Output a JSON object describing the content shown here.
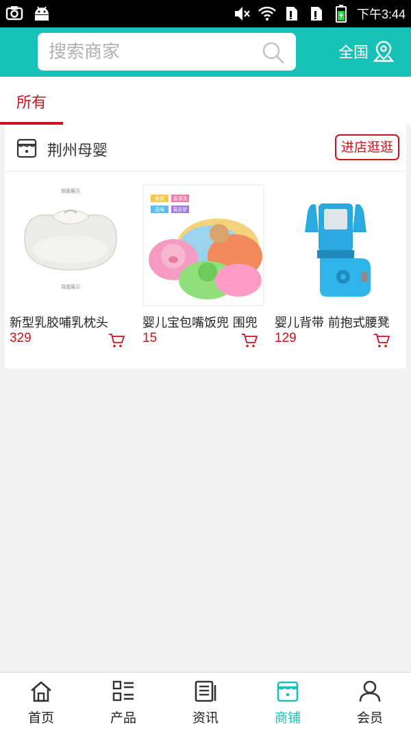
{
  "status_bar": {
    "time": "下午3:44",
    "icons": [
      "camera-icon",
      "android-icon",
      "mute-icon",
      "wifi-icon",
      "sim-icon",
      "sim-icon",
      "battery-icon"
    ]
  },
  "header": {
    "search_placeholder": "搜索商家",
    "region_label": "全国",
    "brand_color": "#16c2b8"
  },
  "tabs": [
    {
      "label": "所有",
      "active": true
    }
  ],
  "shop": {
    "name": "荆州母婴",
    "enter_label": "进店逛逛",
    "accent_color": "#d0111b",
    "products": [
      {
        "name": "新型乳胶哺乳枕头",
        "price": "329",
        "image_caption_top": "侧面展示",
        "image_caption_bottom": "背面展示"
      },
      {
        "name": "婴儿宝包嘴饭兜 围兜",
        "price": "15",
        "tags": [
          "柔软",
          "易清洗",
          "无味",
          "易反折"
        ]
      },
      {
        "name": "婴儿背带 前抱式腰凳",
        "price": "129"
      }
    ]
  },
  "bottom_nav": [
    {
      "label": "首页",
      "icon": "home-icon",
      "active": false
    },
    {
      "label": "产品",
      "icon": "list-icon",
      "active": false
    },
    {
      "label": "资讯",
      "icon": "news-icon",
      "active": false
    },
    {
      "label": "商铺",
      "icon": "shop-icon",
      "active": true
    },
    {
      "label": "会员",
      "icon": "user-icon",
      "active": false
    }
  ]
}
